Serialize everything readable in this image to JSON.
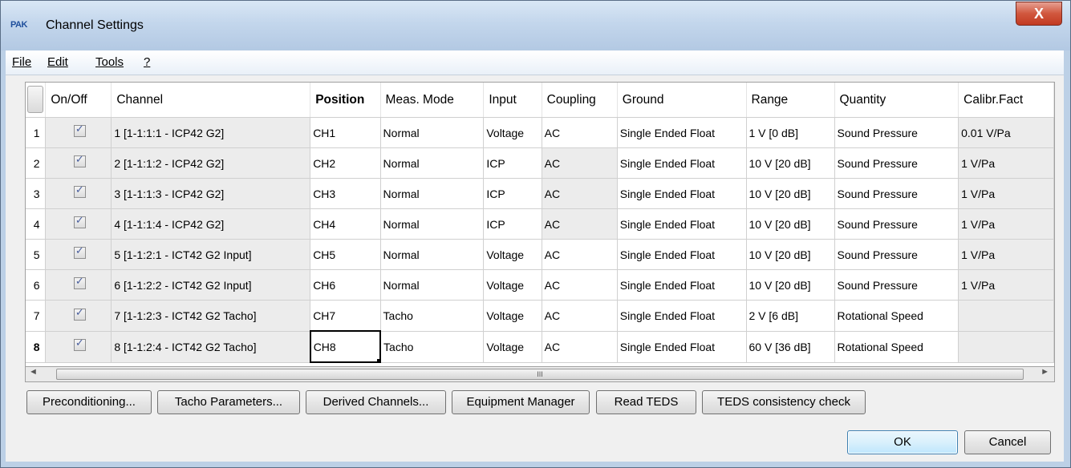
{
  "window": {
    "title": "Channel Settings",
    "logo_text": "PAK",
    "close_glyph": "X"
  },
  "menu": [
    {
      "label": "File"
    },
    {
      "label": "Edit"
    },
    {
      "label": "Tools"
    },
    {
      "label": "?"
    }
  ],
  "grid": {
    "columns": [
      "On/Off",
      "Channel",
      "Position",
      "Meas. Mode",
      "Input",
      "Coupling",
      "Ground",
      "Range",
      "Quantity",
      "Calibr.Fact"
    ],
    "rows": [
      {
        "num": "1",
        "on": true,
        "channel": "1 [1-1:1:1 - ICP42 G2]",
        "position": "CH1",
        "mode": "Normal",
        "input": "Voltage",
        "coupling": "AC",
        "ground": "Single Ended Float",
        "range": "1 V [0 dB]",
        "quantity": "Sound Pressure",
        "calibr": "0.01 V/Pa"
      },
      {
        "num": "2",
        "on": true,
        "channel": "2 [1-1:1:2 - ICP42 G2]",
        "position": "CH2",
        "mode": "Normal",
        "input": "ICP",
        "coupling": "AC",
        "ground": "Single Ended Float",
        "range": "10 V [20 dB]",
        "quantity": "Sound Pressure",
        "calibr": "1 V/Pa"
      },
      {
        "num": "3",
        "on": true,
        "channel": "3 [1-1:1:3 - ICP42 G2]",
        "position": "CH3",
        "mode": "Normal",
        "input": "ICP",
        "coupling": "AC",
        "ground": "Single Ended Float",
        "range": "10 V [20 dB]",
        "quantity": "Sound Pressure",
        "calibr": "1 V/Pa"
      },
      {
        "num": "4",
        "on": true,
        "channel": "4 [1-1:1:4 - ICP42 G2]",
        "position": "CH4",
        "mode": "Normal",
        "input": "ICP",
        "coupling": "AC",
        "ground": "Single Ended Float",
        "range": "10 V [20 dB]",
        "quantity": "Sound Pressure",
        "calibr": "1 V/Pa"
      },
      {
        "num": "5",
        "on": true,
        "channel": "5 [1-1:2:1 - ICT42 G2 Input]",
        "position": "CH5",
        "mode": "Normal",
        "input": "Voltage",
        "coupling": "AC",
        "ground": "Single Ended Float",
        "range": "10 V [20 dB]",
        "quantity": "Sound Pressure",
        "calibr": "1 V/Pa"
      },
      {
        "num": "6",
        "on": true,
        "channel": "6 [1-1:2:2 - ICT42 G2 Input]",
        "position": "CH6",
        "mode": "Normal",
        "input": "Voltage",
        "coupling": "AC",
        "ground": "Single Ended Float",
        "range": "10 V [20 dB]",
        "quantity": "Sound Pressure",
        "calibr": "1 V/Pa"
      },
      {
        "num": "7",
        "on": true,
        "channel": "7 [1-1:2:3 - ICT42 G2 Tacho]",
        "position": "CH7",
        "mode": "Tacho",
        "input": "Voltage",
        "coupling": "AC",
        "ground": "Single Ended Float",
        "range": "2 V [6 dB]",
        "quantity": "Rotational Speed",
        "calibr": ""
      },
      {
        "num": "8",
        "on": true,
        "channel": "8 [1-1:2:4 - ICT42 G2 Tacho]",
        "position": "CH8",
        "mode": "Tacho",
        "input": "Voltage",
        "coupling": "AC",
        "ground": "Single Ended Float",
        "range": "60 V [36 dB]",
        "quantity": "Rotational Speed",
        "calibr": ""
      }
    ]
  },
  "scrollbar": {
    "grip": "III",
    "left_arrow": "◄",
    "right_arrow": "►"
  },
  "actions": [
    {
      "label": "Preconditioning..."
    },
    {
      "label": "Tacho Parameters..."
    },
    {
      "label": "Derived Channels..."
    },
    {
      "label": "Equipment Manager"
    },
    {
      "label": "Read TEDS"
    },
    {
      "label": "TEDS consistency check"
    }
  ],
  "dialog_buttons": {
    "ok": "OK",
    "cancel": "Cancel"
  }
}
